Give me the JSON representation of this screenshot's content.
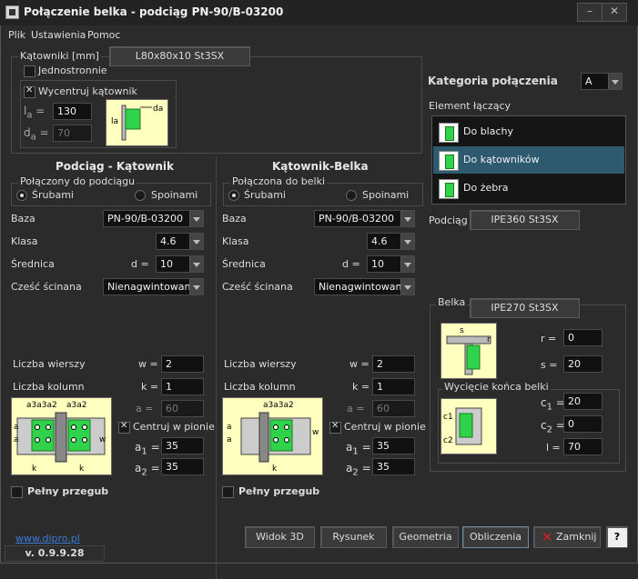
{
  "window": {
    "title": "Połączenie belka - podciąg  PN-90/B-03200",
    "min": "–",
    "close": "✕"
  },
  "menu": [
    "Plik",
    "Ustawienia",
    "Pomoc"
  ],
  "katowniki": {
    "label": "Kątowniki [mm]",
    "profile": "L80x80x10 St3SX",
    "jednostronnie": "Jednostronnie",
    "wycentruj": "Wycentruj kątownik",
    "la_label": "l",
    "la_sub": "a",
    "la_value": "130",
    "da_label": "d",
    "da_sub": "a",
    "da_value": "70"
  },
  "kategoria": {
    "label": "Kategoria połączenia",
    "value": "A"
  },
  "element": {
    "label": "Element łączący",
    "items": [
      "Do blachy",
      "Do kątowników",
      "Do żebra"
    ]
  },
  "podciag": {
    "label": "Podciąg",
    "profile": "IPE360 St3SX"
  },
  "left": {
    "title": "Podciąg - Kątownik",
    "group": "Połączony do podciągu",
    "srubami": "Śrubami",
    "spoinami": "Spoinami",
    "baza_label": "Baza",
    "baza": "PN-90/B-03200",
    "klasa_label": "Klasa",
    "klasa": "4.6",
    "srednica_label": "Średnica",
    "d_label": "d =",
    "srednica": "10",
    "czesc_label": "Cześć ścinana",
    "czesc": "Nienagwintowana",
    "wiersze_label": "Liczba wierszy",
    "w_label": "w =",
    "wiersze": "2",
    "kolumny_label": "Liczba kolumn",
    "k_label": "k =",
    "kolumny": "1",
    "a_label": "a =",
    "a": "60",
    "centruj": "Centruj w pionie",
    "a1_label": "a",
    "a1_sub": "1",
    "eq": "=",
    "a1": "35",
    "a2_label": "a",
    "a2_sub": "2",
    "a2": "35",
    "przegub": "Pełny przegub"
  },
  "right": {
    "title": "Kątownik-Belka",
    "group": "Połączona do belki",
    "srubami": "Śrubami",
    "spoinami": "Spoinami",
    "baza_label": "Baza",
    "baza": "PN-90/B-03200",
    "klasa_label": "Klasa",
    "klasa": "4.6",
    "srednica_label": "Średnica",
    "d_label": "d =",
    "srednica": "10",
    "czesc_label": "Cześć ścinana",
    "czesc": "Nienagwintowana",
    "wiersze_label": "Liczba wierszy",
    "w_label": "w =",
    "wiersze": "2",
    "kolumny_label": "Liczba kolumn",
    "k_label": "k =",
    "kolumny": "1",
    "a_label": "a =",
    "a": "60",
    "centruj": "Centruj w pionie",
    "a1_label": "a",
    "a1_sub": "1",
    "eq": "=",
    "a1": "35",
    "a2_label": "a",
    "a2_sub": "2",
    "a2": "35",
    "przegub": "Pełny przegub"
  },
  "belka": {
    "label": "Belka",
    "profile": "IPE270 St3SX",
    "r_label": "r =",
    "r": "0",
    "s_label": "s =",
    "s": "20",
    "wyciecie": "Wycięcie końca belki",
    "c1_label": "c",
    "c1_sub": "1",
    "eq": "=",
    "c1": "20",
    "c2_label": "c",
    "c2_sub": "2",
    "c2": "0",
    "l_label": "l =",
    "l": "70"
  },
  "footer": {
    "link": "www.dipro.pl",
    "version": "v. 0.9.9.28",
    "buttons": [
      "Widok 3D",
      "Rysunek",
      "Geometria",
      "Obliczenia",
      "Zamknij"
    ],
    "help": "?"
  },
  "colors": {
    "accent_selected": "#2e5a70",
    "drawing_bg": "#ffffc0",
    "bolt_green": "#2fd24a",
    "link": "#3b7bd8",
    "close_red": "#d02020"
  }
}
